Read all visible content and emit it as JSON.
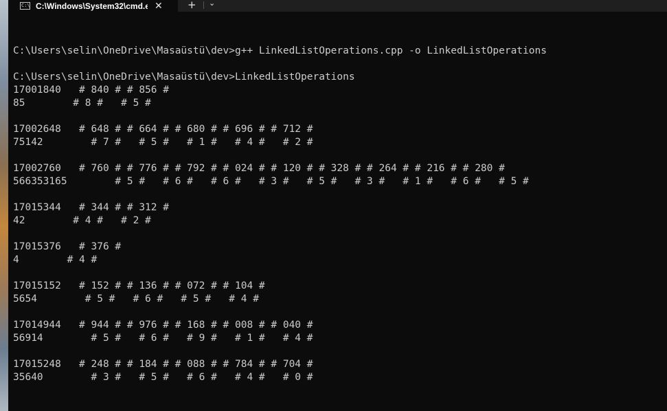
{
  "window": {
    "tab_title": "C:\\Windows\\System32\\cmd.e",
    "tab_icon_glyph": "C:\\",
    "close_glyph": "✕",
    "new_tab_glyph": "+",
    "dropdown_glyph": "⌄"
  },
  "console": {
    "lines": [
      "C:\\Users\\selin\\OneDrive\\Masaüstü\\dev>g++ LinkedListOperations.cpp -o LinkedListOperations",
      "",
      "C:\\Users\\selin\\OneDrive\\Masaüstü\\dev>LinkedListOperations",
      "17001840   # 840 # # 856 #",
      "85        # 8 #   # 5 #",
      "",
      "17002648   # 648 # # 664 # # 680 # # 696 # # 712 #",
      "75142        # 7 #   # 5 #   # 1 #   # 4 #   # 2 #",
      "",
      "17002760   # 760 # # 776 # # 792 # # 024 # # 120 # # 328 # # 264 # # 216 # # 280 #",
      "566353165        # 5 #   # 6 #   # 6 #   # 3 #   # 5 #   # 3 #   # 1 #   # 6 #   # 5 #",
      "",
      "17015344   # 344 # # 312 #",
      "42        # 4 #   # 2 #",
      "",
      "17015376   # 376 #",
      "4        # 4 #",
      "",
      "17015152   # 152 # # 136 # # 072 # # 104 #",
      "5654        # 5 #   # 6 #   # 5 #   # 4 #",
      "",
      "17014944   # 944 # # 976 # # 168 # # 008 # # 040 #",
      "56914        # 5 #   # 6 #   # 9 #   # 1 #   # 4 #",
      "",
      "17015248   # 248 # # 184 # # 088 # # 784 # # 704 #",
      "35640        # 3 #   # 5 #   # 6 #   # 4 #   # 0 #"
    ]
  }
}
